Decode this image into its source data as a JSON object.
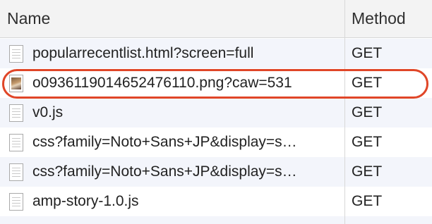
{
  "columns": {
    "name": "Name",
    "method": "Method"
  },
  "rows": [
    {
      "name": "popularrecentlist.html?screen=full",
      "method": "GET",
      "icon": "document-icon"
    },
    {
      "name": "o0936119014652476110.png?caw=531",
      "method": "GET",
      "icon": "image-icon"
    },
    {
      "name": "v0.js",
      "method": "GET",
      "icon": "document-icon"
    },
    {
      "name": "css?family=Noto+Sans+JP&display=s…",
      "method": "GET",
      "icon": "document-icon"
    },
    {
      "name": "css?family=Noto+Sans+JP&display=s…",
      "method": "GET",
      "icon": "document-icon"
    },
    {
      "name": "amp-story-1.0.js",
      "method": "GET",
      "icon": "document-icon"
    }
  ],
  "colors": {
    "highlight": "#e04628",
    "header_bg": "#f3f3f3",
    "alt_row_bg": "#f3f5fb"
  }
}
